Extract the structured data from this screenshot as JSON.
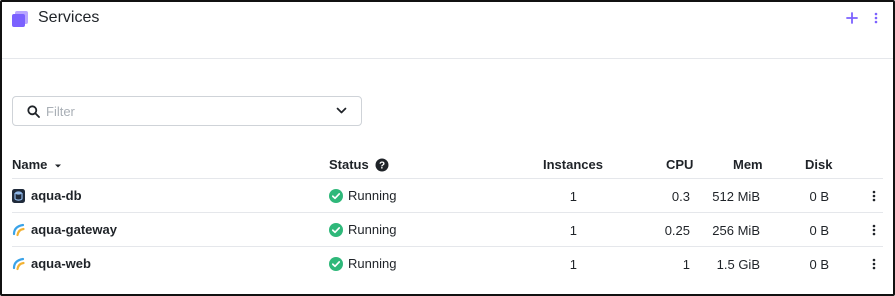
{
  "header": {
    "title": "Services",
    "accent_color": "#7b61ff"
  },
  "filter": {
    "placeholder": "Filter",
    "value": ""
  },
  "table": {
    "columns": {
      "name": "Name",
      "status": "Status",
      "instances": "Instances",
      "cpu": "CPU",
      "mem": "Mem",
      "disk": "Disk"
    },
    "rows": [
      {
        "name": "aqua-db",
        "icon": "database-icon",
        "status": "Running",
        "instances": "1",
        "cpu": "0.3",
        "mem": "512 MiB",
        "disk": "0 B"
      },
      {
        "name": "aqua-gateway",
        "icon": "web-service-icon",
        "status": "Running",
        "instances": "1",
        "cpu": "0.25",
        "mem": "256 MiB",
        "disk": "0 B"
      },
      {
        "name": "aqua-web",
        "icon": "web-service-icon",
        "status": "Running",
        "instances": "1",
        "cpu": "1",
        "mem": "1.5 GiB",
        "disk": "0 B"
      }
    ]
  },
  "colors": {
    "running_green": "#2fb87a",
    "border": "#e5e7eb"
  }
}
